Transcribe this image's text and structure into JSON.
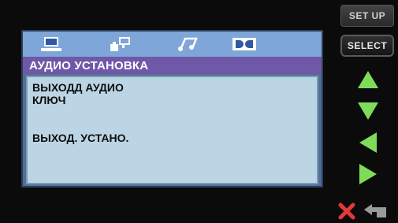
{
  "osd": {
    "tabs": [
      {
        "icon": "monitor-icon"
      },
      {
        "icon": "speaker-icon"
      },
      {
        "icon": "music-note-icon"
      },
      {
        "icon": "dolby-icon"
      }
    ],
    "title": "АУДИО УСТАНОВКА",
    "items": [
      "ВЫХОДД АУДИО",
      "КЛЮЧ",
      "ВЫХОД. УСТАНО."
    ]
  },
  "side": {
    "setup_label": "SET UP",
    "select_label": "SELECT",
    "arrows": [
      "arrow-up-icon",
      "arrow-down-icon",
      "arrow-left-icon",
      "arrow-right-icon"
    ]
  },
  "bottom": {
    "icons": [
      "close-icon",
      "return-icon"
    ]
  },
  "colors": {
    "tab_bar": "#7ea6d8",
    "title_bar": "#6f58a8",
    "content_bg": "#bcd5e4",
    "arrow_green": "#7fdc58"
  }
}
